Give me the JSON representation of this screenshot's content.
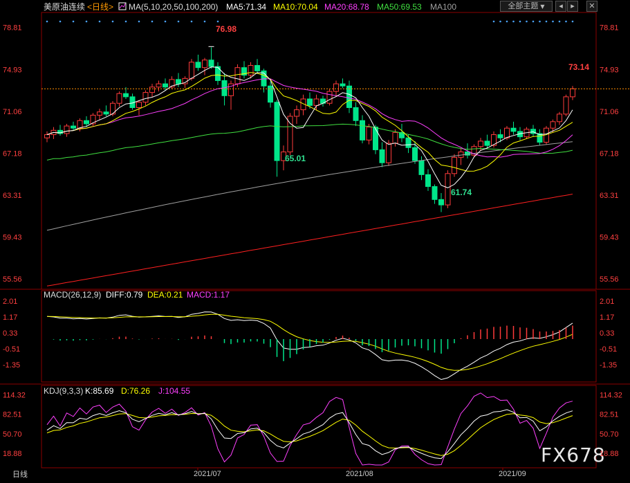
{
  "header": {
    "title": "美原油连续",
    "period": "<日线>",
    "ma_label": "MA(5,10,20,50,100,200)",
    "ma5": "MA5:71.34",
    "ma10": "MA10:70.04",
    "ma20": "MA20:68.78",
    "ma50": "MA50:69.53",
    "ma100": "MA100",
    "theme_button": "全部主题",
    "theme_arrow": "▼"
  },
  "colors": {
    "up": "#ff3b3b",
    "down": "#00e68a",
    "ma5": "#ffffff",
    "ma10": "#ffff00",
    "ma20": "#ff40ff",
    "ma50": "#40e040",
    "ma100": "#a0a0a0",
    "ma200": "#ff2020",
    "axis_text": "#ff4040",
    "price_line": "#ff8c00"
  },
  "price_axis": [
    "78.81",
    "74.93",
    "71.06",
    "67.18",
    "63.31",
    "59.43",
    "55.56"
  ],
  "annotations": {
    "high": "76.98",
    "low1": "65.01",
    "low2": "61.74",
    "last": "73.14"
  },
  "macd": {
    "label": "MACD(26,12,9)",
    "diff": "DIFF:0.79",
    "dea": "DEA:0.21",
    "macd": "MACD:1.17",
    "axis": [
      "2.01",
      "1.17",
      "0.33",
      "-0.51",
      "-1.35"
    ]
  },
  "kdj": {
    "label": "KDJ(9,3,3)",
    "k": "K:85.69",
    "d": "D:76.26",
    "j": "J:104.55",
    "axis": [
      "114.32",
      "82.51",
      "50.70",
      "18.88"
    ]
  },
  "x_axis": [
    "2021/07",
    "2021/08",
    "2021/09"
  ],
  "footer": {
    "period": "日线",
    "watermark": "FX678"
  },
  "chart_data": {
    "type": "candlestick",
    "ylim": [
      54.0,
      80.0
    ],
    "candles": [
      [
        68.6,
        69.2,
        68.2,
        68.9
      ],
      [
        68.9,
        69.6,
        68.5,
        69.3
      ],
      [
        69.3,
        69.8,
        68.8,
        69.0
      ],
      [
        69.0,
        69.9,
        68.7,
        69.7
      ],
      [
        69.7,
        70.1,
        69.3,
        69.5
      ],
      [
        69.5,
        70.4,
        69.2,
        70.2
      ],
      [
        70.2,
        70.6,
        69.6,
        69.9
      ],
      [
        69.9,
        70.9,
        69.7,
        70.7
      ],
      [
        70.7,
        71.3,
        70.3,
        71.0
      ],
      [
        71.0,
        71.6,
        70.6,
        70.8
      ],
      [
        70.8,
        72.0,
        70.6,
        71.8
      ],
      [
        71.8,
        72.9,
        71.5,
        72.7
      ],
      [
        72.7,
        73.3,
        72.2,
        72.4
      ],
      [
        72.4,
        72.7,
        71.2,
        71.4
      ],
      [
        71.4,
        72.1,
        70.7,
        71.9
      ],
      [
        71.9,
        73.0,
        71.6,
        72.8
      ],
      [
        72.8,
        73.6,
        72.4,
        73.3
      ],
      [
        73.3,
        73.9,
        72.9,
        73.6
      ],
      [
        73.6,
        74.1,
        73.0,
        73.3
      ],
      [
        73.3,
        74.3,
        73.1,
        74.0
      ],
      [
        74.0,
        74.6,
        73.3,
        73.6
      ],
      [
        73.6,
        74.3,
        73.2,
        74.1
      ],
      [
        74.1,
        75.9,
        73.9,
        75.6
      ],
      [
        75.6,
        76.3,
        74.8,
        75.1
      ],
      [
        75.1,
        76.0,
        74.4,
        75.8
      ],
      [
        75.8,
        76.98,
        75.0,
        75.2
      ],
      [
        75.2,
        75.6,
        73.5,
        73.9
      ],
      [
        73.9,
        74.6,
        71.6,
        72.5
      ],
      [
        72.5,
        73.9,
        71.2,
        73.6
      ],
      [
        73.6,
        75.4,
        73.3,
        75.1
      ],
      [
        75.1,
        75.7,
        74.1,
        74.4
      ],
      [
        74.4,
        75.6,
        74.1,
        75.3
      ],
      [
        75.3,
        75.9,
        74.6,
        74.8
      ],
      [
        74.8,
        75.0,
        72.8,
        73.4
      ],
      [
        73.4,
        73.8,
        71.4,
        71.9
      ],
      [
        71.9,
        72.1,
        65.01,
        66.5
      ],
      [
        66.5,
        67.9,
        65.6,
        67.3
      ],
      [
        67.3,
        70.9,
        67.0,
        70.6
      ],
      [
        70.6,
        71.6,
        69.9,
        71.2
      ],
      [
        71.2,
        72.6,
        70.7,
        72.2
      ],
      [
        72.2,
        72.8,
        71.3,
        71.6
      ],
      [
        71.6,
        72.6,
        71.2,
        72.2
      ],
      [
        72.2,
        72.5,
        71.5,
        71.8
      ],
      [
        71.8,
        73.1,
        71.6,
        72.9
      ],
      [
        72.9,
        73.9,
        72.4,
        73.6
      ],
      [
        73.6,
        74.1,
        73.2,
        73.4
      ],
      [
        73.4,
        73.9,
        70.9,
        71.4
      ],
      [
        71.4,
        71.9,
        69.7,
        70.2
      ],
      [
        70.2,
        70.7,
        68.1,
        68.4
      ],
      [
        68.4,
        69.9,
        68.0,
        69.6
      ],
      [
        69.6,
        69.8,
        67.1,
        67.5
      ],
      [
        67.5,
        68.2,
        65.9,
        66.3
      ],
      [
        66.3,
        68.4,
        66.0,
        68.1
      ],
      [
        68.1,
        69.4,
        67.8,
        69.1
      ],
      [
        69.1,
        69.9,
        68.2,
        68.6
      ],
      [
        68.6,
        68.9,
        67.2,
        67.7
      ],
      [
        67.7,
        68.3,
        66.2,
        66.5
      ],
      [
        66.5,
        66.9,
        64.7,
        65.2
      ],
      [
        65.2,
        65.7,
        63.7,
        64.1
      ],
      [
        64.1,
        64.3,
        62.5,
        62.9
      ],
      [
        62.9,
        63.5,
        61.74,
        62.4
      ],
      [
        62.4,
        65.6,
        62.1,
        65.3
      ],
      [
        65.3,
        67.1,
        65.0,
        66.8
      ],
      [
        66.8,
        67.6,
        66.1,
        67.3
      ],
      [
        67.3,
        68.1,
        66.7,
        67.0
      ],
      [
        67.0,
        68.0,
        66.8,
        67.8
      ],
      [
        67.8,
        68.6,
        67.4,
        68.3
      ],
      [
        68.3,
        68.9,
        67.6,
        67.9
      ],
      [
        67.9,
        69.2,
        67.7,
        68.9
      ],
      [
        68.9,
        69.4,
        68.2,
        68.6
      ],
      [
        68.6,
        69.7,
        68.4,
        69.5
      ],
      [
        69.5,
        70.1,
        68.9,
        69.2
      ],
      [
        69.2,
        69.6,
        68.4,
        68.7
      ],
      [
        68.7,
        69.6,
        68.5,
        69.4
      ],
      [
        69.4,
        69.8,
        68.7,
        69.0
      ],
      [
        69.0,
        69.4,
        67.9,
        68.2
      ],
      [
        68.2,
        69.7,
        68.0,
        69.5
      ],
      [
        69.5,
        70.3,
        69.1,
        70.1
      ],
      [
        70.1,
        71.0,
        69.8,
        70.8
      ],
      [
        70.8,
        72.6,
        70.6,
        72.4
      ],
      [
        72.4,
        73.4,
        72.1,
        73.14
      ]
    ]
  }
}
